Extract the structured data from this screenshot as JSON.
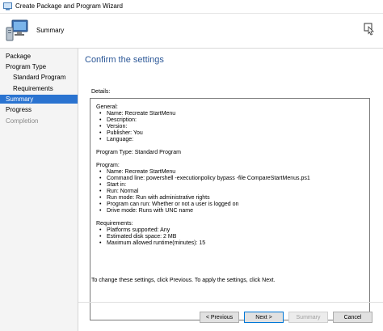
{
  "window": {
    "title": "Create Package and Program Wizard"
  },
  "banner": {
    "title": "Summary"
  },
  "sidebar": {
    "items": [
      {
        "label": "Package"
      },
      {
        "label": "Program Type"
      },
      {
        "label": "Standard Program"
      },
      {
        "label": "Requirements"
      },
      {
        "label": "Summary"
      },
      {
        "label": "Progress"
      },
      {
        "label": "Completion"
      }
    ]
  },
  "main": {
    "heading": "Confirm the settings",
    "details_label": "Details:",
    "details": {
      "general_header": "General:",
      "general": [
        "Name: Recreate StartMenu",
        "Description:",
        "Version:",
        "Publisher: You",
        "Language:"
      ],
      "program_type": "Program Type: Standard Program",
      "program_header": "Program:",
      "program": [
        "Name: Recreate StartMenu",
        "Command line: powershell -executionpolicy bypass -file CompareStartMenus.ps1",
        "Start in:",
        "Run: Normal",
        "Run mode: Run with administrative rights",
        "Program can run: Whether or not a user is logged on",
        "Drive mode: Runs with UNC name"
      ],
      "requirements_header": "Requirements:",
      "requirements": [
        "Platforms supported: Any",
        "Estimated disk space: 2 MB",
        "Maximum allowed runtime(minutes): 15"
      ]
    },
    "info_text": "To change these settings, click Previous. To apply the settings, click Next."
  },
  "buttons": {
    "previous": "< Previous",
    "next": "Next >",
    "summary": "Summary",
    "cancel": "Cancel"
  }
}
